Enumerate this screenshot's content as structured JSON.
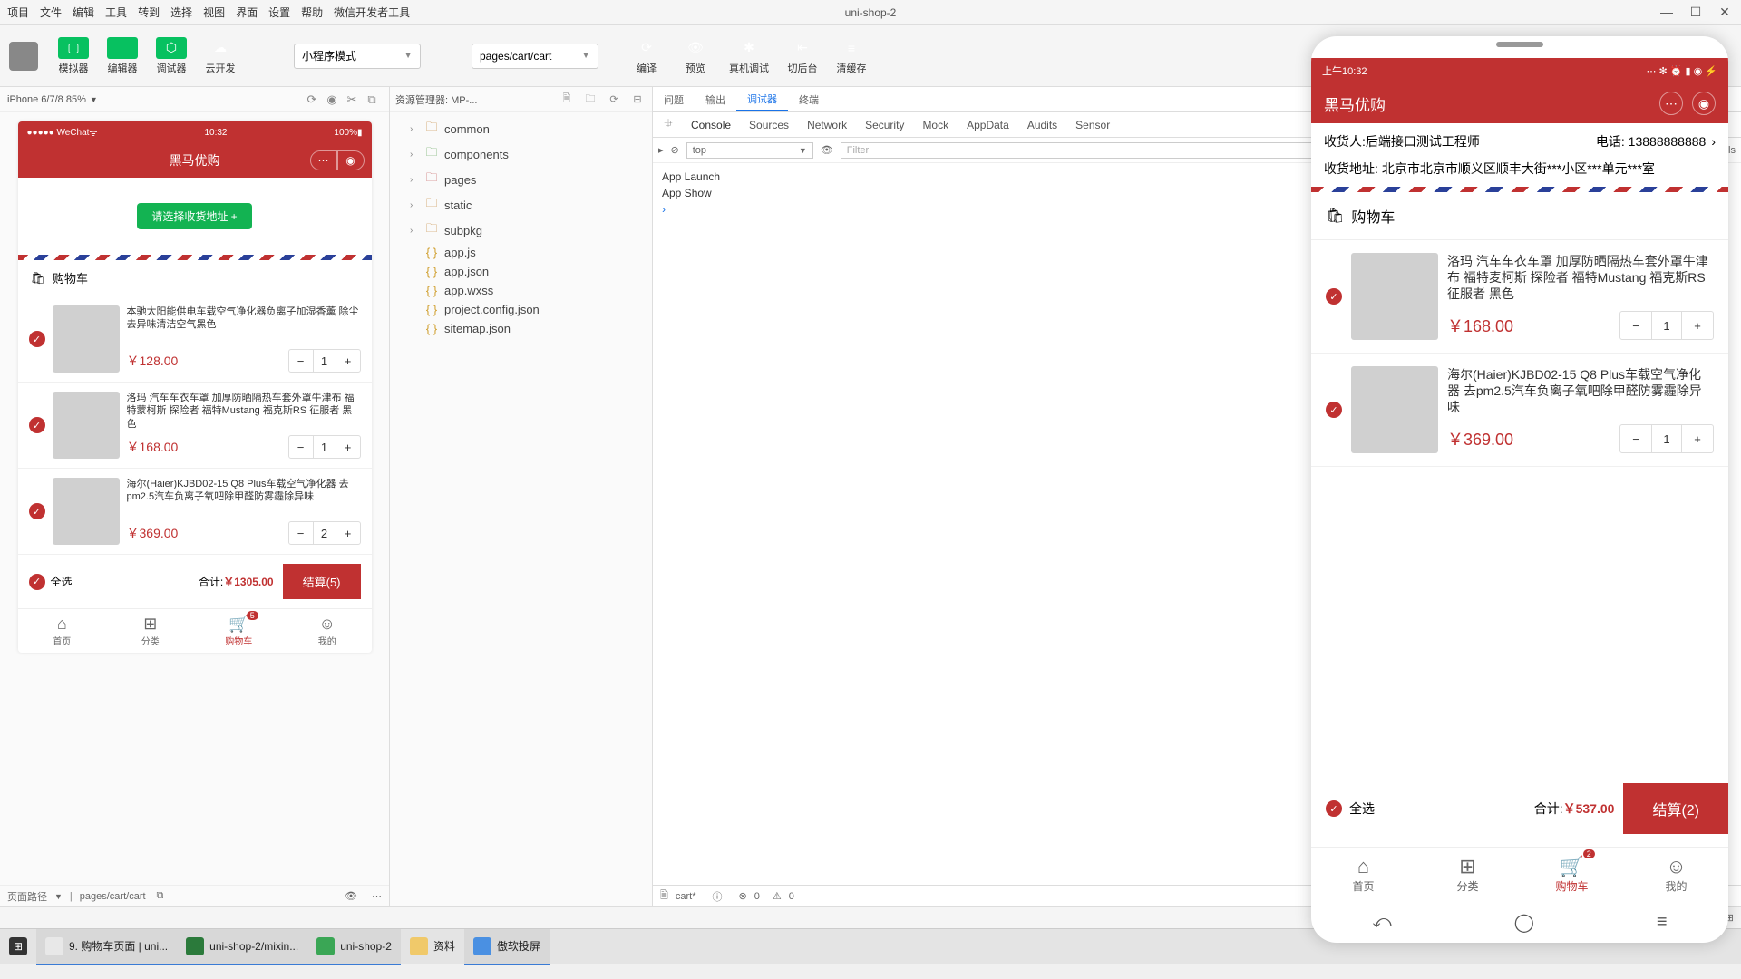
{
  "window": {
    "title": "uni-shop-2"
  },
  "menu": [
    "项目",
    "文件",
    "编辑",
    "工具",
    "转到",
    "选择",
    "视图",
    "界面",
    "设置",
    "帮助",
    "微信开发者工具"
  ],
  "toolbar": {
    "buttons": [
      {
        "key": "simulator",
        "label": "模拟器"
      },
      {
        "key": "editor",
        "label": "编辑器"
      },
      {
        "key": "debugger",
        "label": "调试器"
      },
      {
        "key": "clouddev",
        "label": "云开发"
      }
    ],
    "mode_select": "小程序模式",
    "page_select": "pages/cart/cart",
    "right": [
      {
        "key": "compile",
        "label": "编译"
      },
      {
        "key": "preview",
        "label": "预览"
      },
      {
        "key": "realdebug",
        "label": "真机调试"
      },
      {
        "key": "background",
        "label": "切后台"
      },
      {
        "key": "clearcache",
        "label": "清缓存"
      }
    ]
  },
  "sim": {
    "device": "iPhone 6/7/8 85%",
    "status_left": "●●●●● WeChat",
    "status_time": "10:32",
    "status_right": "100%",
    "nav_title": "黑马优购",
    "addr_btn": "请选择收货地址 +",
    "cart_title": "购物车",
    "items": [
      {
        "name": "本驰太阳能供电车载空气净化器负离子加湿香薰 除尘去异味清洁空气黑色",
        "price": "￥128.00",
        "qty": "1"
      },
      {
        "name": "洛玛 汽车车衣车罩 加厚防晒隔热车套外罩牛津布 福特蒙柯斯 探险者 福特Mustang 福克斯RS 征服者 黑色",
        "price": "￥168.00",
        "qty": "1"
      },
      {
        "name": "海尔(Haier)KJBD02-15 Q8 Plus车载空气净化器 去pm2.5汽车负离子氧吧除甲醛防雾霾除异味",
        "price": "￥369.00",
        "qty": "2"
      }
    ],
    "select_all": "全选",
    "total_label": "合计:",
    "total_price": "￥1305.00",
    "checkout": "结算(5)",
    "tabs": [
      {
        "label": "首页",
        "icon": "⌂"
      },
      {
        "label": "分类",
        "icon": "⊞"
      },
      {
        "label": "购物车",
        "icon": "🛒",
        "active": true,
        "badge": "5"
      },
      {
        "label": "我的",
        "icon": "☺"
      }
    ],
    "footer_path_label": "页面路径",
    "footer_path": "pages/cart/cart"
  },
  "explorer": {
    "title": "资源管理器: MP-...",
    "tree": [
      {
        "type": "folder",
        "name": "common",
        "cls": "folder"
      },
      {
        "type": "folder",
        "name": "components",
        "cls": "folder-g"
      },
      {
        "type": "folder",
        "name": "pages",
        "cls": "folder-r"
      },
      {
        "type": "folder",
        "name": "static",
        "cls": "folder"
      },
      {
        "type": "folder",
        "name": "subpkg",
        "cls": "folder"
      },
      {
        "type": "file",
        "name": "app.js",
        "cls": "jsfile"
      },
      {
        "type": "file",
        "name": "app.json",
        "cls": "jsfile"
      },
      {
        "type": "file",
        "name": "app.wxss",
        "cls": "jsfile"
      },
      {
        "type": "file",
        "name": "project.config.json",
        "cls": "jsfile"
      },
      {
        "type": "file",
        "name": "sitemap.json",
        "cls": "jsfile"
      }
    ],
    "footer": {
      "tab": "cart*",
      "err": "0",
      "warn": "0"
    }
  },
  "devtools": {
    "outer_tabs": [
      "问题",
      "输出",
      "调试器",
      "终端"
    ],
    "outer_active": "调试器",
    "tabs": [
      "Console",
      "Sources",
      "Network",
      "Security",
      "Mock",
      "AppData",
      "Audits",
      "Sensor"
    ],
    "active_tab": "Console",
    "context": "top",
    "filter_ph": "Filter",
    "levels": "Default levels",
    "logs": [
      "App Launch",
      "App Show"
    ]
  },
  "mirror": {
    "status_time": "上午10:32",
    "nav_title": "黑马优购",
    "consignee_label": "收货人:",
    "consignee": "后端接口测试工程师",
    "phone_label": "电话:",
    "phone": "13888888888",
    "addr_label": "收货地址:",
    "addr": "北京市北京市顺义区顺丰大街***小区***单元***室",
    "cart_title": "购物车",
    "items": [
      {
        "name": "洛玛 汽车车衣车罩 加厚防晒隔热车套外罩牛津布 福特麦柯斯 探险者 福特Mustang 福克斯RS 征服者 黑色",
        "price": "￥168.00",
        "qty": "1"
      },
      {
        "name": "海尔(Haier)KJBD02-15 Q8 Plus车载空气净化器 去pm2.5汽车负离子氧吧除甲醛防雾霾除异味",
        "price": "￥369.00",
        "qty": "1"
      }
    ],
    "select_all": "全选",
    "total_label": "合计:",
    "total_price": "￥537.00",
    "checkout": "结算(2)",
    "tabs": [
      {
        "label": "首页",
        "icon": "⌂"
      },
      {
        "label": "分类",
        "icon": "⊞"
      },
      {
        "label": "购物车",
        "icon": "🛒",
        "active": true,
        "badge": "2"
      },
      {
        "label": "我的",
        "icon": "☺"
      }
    ]
  },
  "taskbar": [
    {
      "label": "9. 购物车页面 | uni...",
      "color": "#e8e8e8",
      "active": true
    },
    {
      "label": "uni-shop-2/mixin...",
      "color": "#2b7a3b",
      "active": true
    },
    {
      "label": "uni-shop-2",
      "color": "#3aa655",
      "active": true
    },
    {
      "label": "资料",
      "color": "#f0c96a",
      "active": false
    },
    {
      "label": "傲软投屏",
      "color": "#4a90e2",
      "active": true
    }
  ]
}
